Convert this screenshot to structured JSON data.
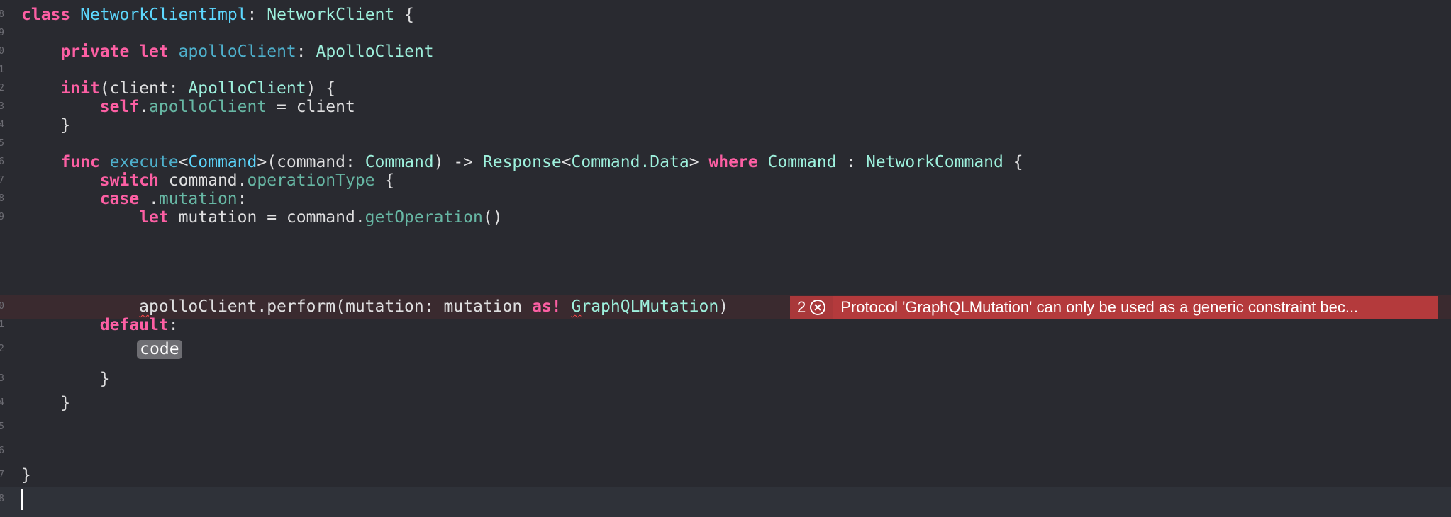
{
  "gutter": [
    "8",
    "9",
    "0",
    "1",
    "2",
    "3",
    "4",
    "5",
    "6",
    "7",
    "8",
    "9",
    "0",
    "1",
    "2",
    "3",
    "4",
    "5",
    "6",
    "7",
    "8"
  ],
  "code": {
    "l1": {
      "kw_class": "class",
      "class_name": "NetworkClientImpl",
      "colon": ": ",
      "protocol": "NetworkClient",
      "brace": " {"
    },
    "l3": {
      "indent": "    ",
      "kw_private": "private",
      "sp1": " ",
      "kw_let": "let",
      "sp2": " ",
      "prop": "apolloClient",
      "colon": ": ",
      "type": "ApolloClient"
    },
    "l5": {
      "indent": "    ",
      "kw_init": "init",
      "open": "(client: ",
      "type": "ApolloClient",
      "close": ") {"
    },
    "l6": {
      "indent": "        ",
      "kw_self": "self",
      "dot": ".",
      "prop": "apolloClient",
      "rest": " = client"
    },
    "l7": {
      "indent": "    ",
      "brace": "}"
    },
    "l9": {
      "indent": "    ",
      "kw_func": "func",
      "sp": " ",
      "fn": "execute",
      "lt": "<",
      "generic": "Command",
      "gt": ">(command: ",
      "type1": "Command",
      "arrow": ") -> ",
      "type2": "Response",
      "lt2": "<",
      "type3": "Command.Data",
      "gt2": "> ",
      "kw_where": "where",
      "sp2": " ",
      "type4": "Command",
      "col": " : ",
      "type5": "NetworkCommand",
      "brace": " {"
    },
    "l10": {
      "indent": "        ",
      "kw_switch": "switch",
      "sp": " command.",
      "prop": "operationType",
      "brace": " {"
    },
    "l11": {
      "indent": "        ",
      "kw_case": "case",
      "sp": " .",
      "member": "mutation",
      "colon": ":"
    },
    "l12": {
      "indent": "            ",
      "kw_let": "let",
      "mid": " mutation = command.",
      "fn": "getOperation",
      "paren": "()"
    },
    "l13": {
      "indent": "            ",
      "first": "a",
      "rest1": "polloClient.perform(mutation: mutation ",
      "kw_as": "as!",
      "sp": " ",
      "type_err_first": "G",
      "type_err_rest": "raphQLMutation",
      "close": ")"
    },
    "l14": {
      "indent": "        ",
      "kw_default": "default",
      "colon": ":"
    },
    "l15": {
      "indent": "            ",
      "placeholder": "code"
    },
    "l16": {
      "indent": "        ",
      "brace": "}"
    },
    "l17": {
      "indent": "    ",
      "brace": "}"
    },
    "l20": {
      "brace": "}"
    }
  },
  "error": {
    "count": "2",
    "message": "Protocol 'GraphQLMutation' can only be used as a generic constraint bec..."
  },
  "colors": {
    "background": "#292a30",
    "keyword": "#fc5fa3",
    "type": "#9ef1dd",
    "declaration": "#5dd8ff",
    "property": "#67b7a4",
    "error": "#b43a3c"
  }
}
